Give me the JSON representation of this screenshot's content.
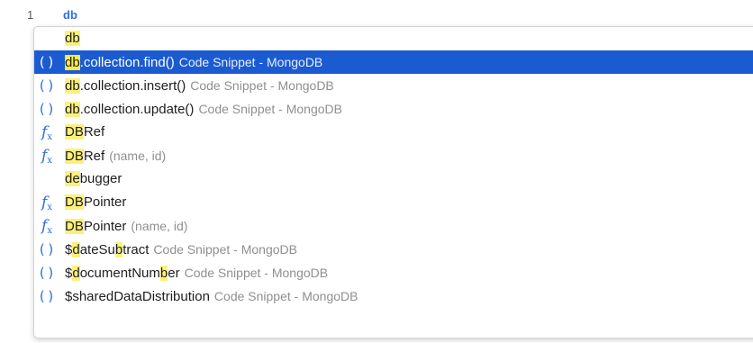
{
  "editor": {
    "line_number": "1",
    "code": "db"
  },
  "suggestions": [
    {
      "icon": "none",
      "pre": "",
      "match": "db",
      "post": "",
      "detail": ""
    },
    {
      "icon": "snippet",
      "pre": "",
      "match": "db",
      "post": ".collection.find()",
      "detail": "Code Snippet - MongoDB"
    },
    {
      "icon": "snippet",
      "pre": "",
      "match": "db",
      "post": ".collection.insert()",
      "detail": "Code Snippet - MongoDB"
    },
    {
      "icon": "snippet",
      "pre": "",
      "match": "db",
      "post": ".collection.update()",
      "detail": "Code Snippet - MongoDB"
    },
    {
      "icon": "function",
      "pre": "",
      "match": "DB",
      "post": "Ref",
      "detail": ""
    },
    {
      "icon": "function",
      "pre": "",
      "match": "DB",
      "post": "Ref",
      "detail": "(name, id)"
    },
    {
      "icon": "none",
      "pre": "",
      "match": "de",
      "post": "bugger",
      "detail": ""
    },
    {
      "icon": "function",
      "pre": "",
      "match": "DB",
      "post": "Pointer",
      "detail": ""
    },
    {
      "icon": "function",
      "pre": "",
      "match": "DB",
      "post": "Pointer",
      "detail": "(name, id)"
    },
    {
      "icon": "snippet",
      "pre": "$",
      "match": "d",
      "post": "ateSu",
      "match2": "b",
      "post2": "tract",
      "detail": "Code Snippet - MongoDB"
    },
    {
      "icon": "snippet",
      "pre": "$",
      "match": "d",
      "post": "ocumentNum",
      "match2": "b",
      "post2": "er",
      "detail": "Code Snippet - MongoDB"
    },
    {
      "icon": "snippet",
      "pre": "$",
      "match": "",
      "post": "sharedDataDistribution",
      "detail": "Code Snippet - MongoDB"
    }
  ],
  "selected_index": 1,
  "icons": {
    "snippet": "()",
    "function": "f"
  },
  "colors": {
    "selection": "#1b5bd1",
    "match_highlight": "#fcf07c",
    "icon": "#2a6fdb"
  }
}
